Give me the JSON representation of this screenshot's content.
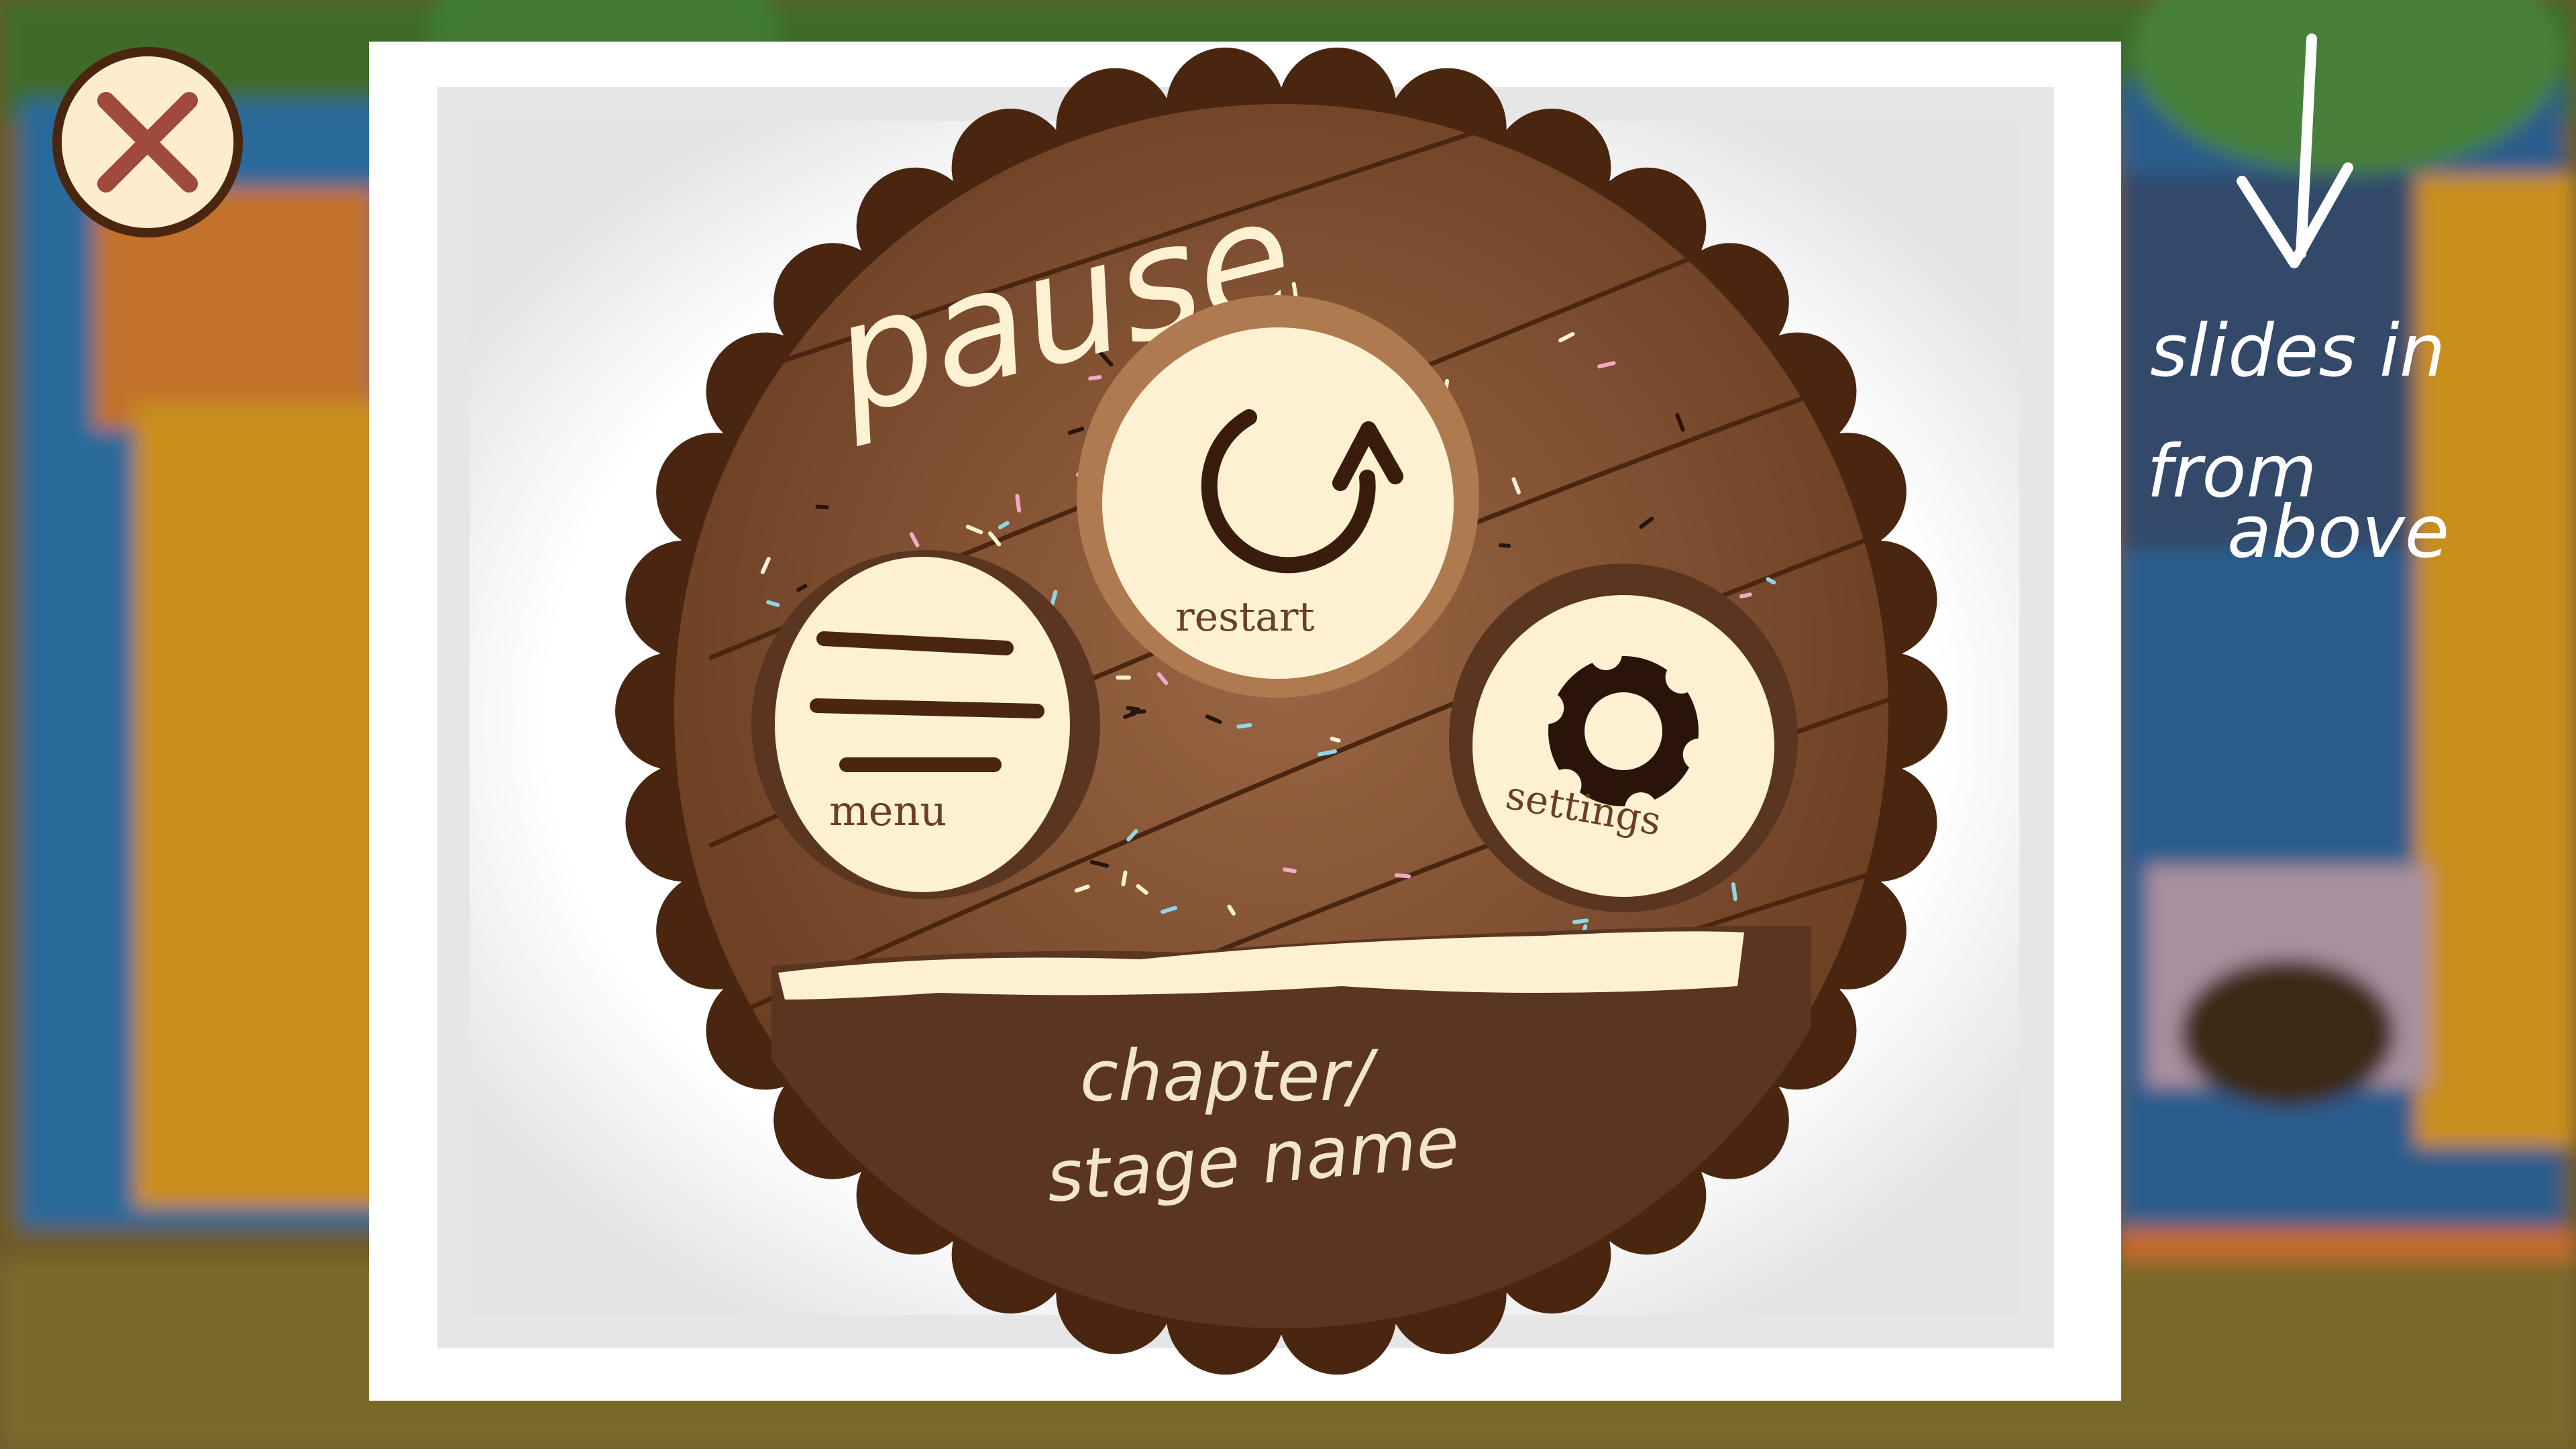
{
  "pause_menu": {
    "title": "pause",
    "buttons": {
      "restart": {
        "label": "restart"
      },
      "menu": {
        "label": "menu"
      },
      "settings": {
        "label": "settings"
      }
    },
    "stage_name_line1": "chapter/",
    "stage_name_line2": "stage name"
  },
  "annotation": {
    "line1": "slides in",
    "line2": "from",
    "line3": "above"
  },
  "icons": {
    "close": "close-icon",
    "restart": "restart-arrow-icon",
    "menu": "hamburger-menu-icon",
    "settings": "gear-icon",
    "annotation_arrow": "down-arrow-icon"
  },
  "colors": {
    "cookie_edge": "#4a2610",
    "cookie_body": "#7a4a2c",
    "cream": "#fdf1d2",
    "frame": "#ffffff"
  }
}
